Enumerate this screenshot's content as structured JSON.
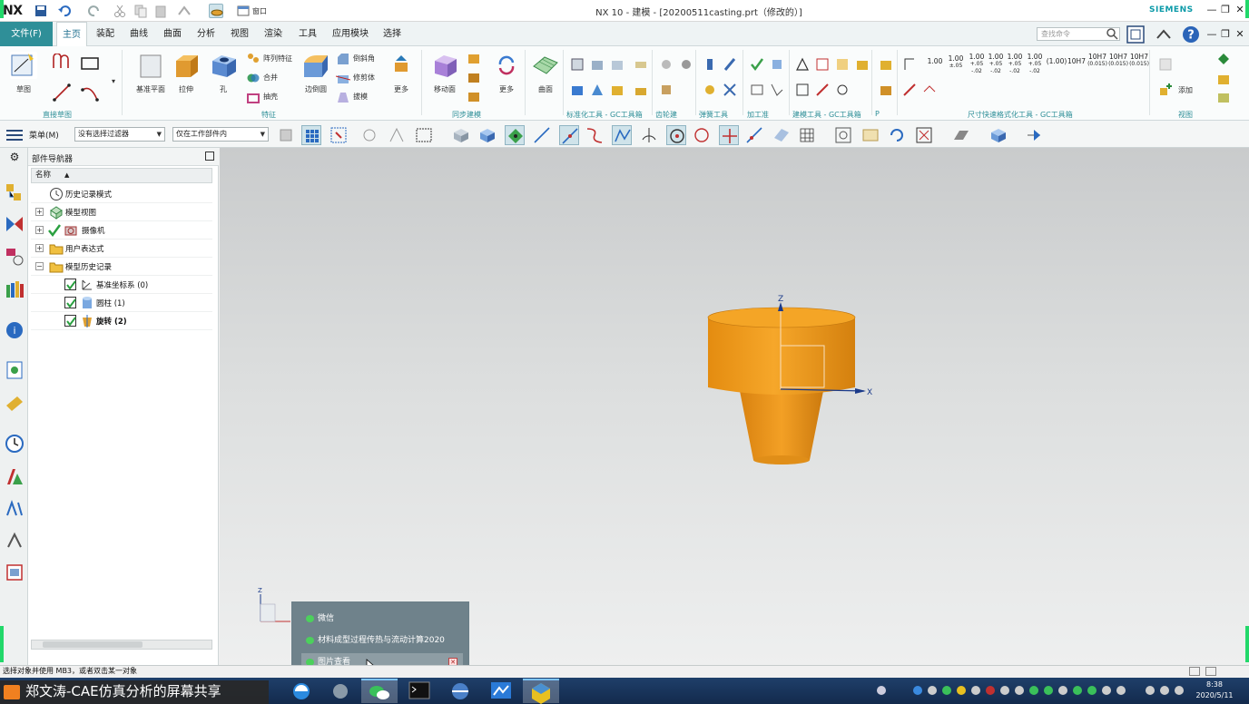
{
  "titlebar": {
    "logo": "NX",
    "window_menu": "窗口",
    "title": "NX 10 - 建模 - [20200511casting.prt（修改的）]",
    "brand": "SIEMENS",
    "min": "—",
    "restore": "❐",
    "close": "✕"
  },
  "menu_tabs": {
    "file": "文件(F)",
    "tabs": [
      "主页",
      "装配",
      "曲线",
      "曲面",
      "分析",
      "视图",
      "渲染",
      "工具",
      "应用模块",
      "选择"
    ],
    "search_placeholder": "查找命令"
  },
  "ribbon": {
    "big_buttons": [
      "草图",
      "基准平面",
      "拉伸",
      "孔",
      "边倒圆",
      "移动面",
      "更多",
      "更多",
      "曲面",
      "更多"
    ],
    "small_labels": [
      "阵列特征",
      "合并",
      "抽壳",
      "倒斜角",
      "修剪体",
      "拔模",
      "添加"
    ],
    "groups": [
      "直接草图",
      "特征",
      "同步建模",
      "标准化工具 - GC工具箱",
      "齿轮建",
      "弹簧工具",
      "加工准",
      "建模工具 - GC工具箱",
      "P",
      "尺寸快速格式化工具 - GC工具箱",
      "视图"
    ],
    "tolerances": [
      {
        "top": "1.00",
        "bottom": ""
      },
      {
        "top": "1.00",
        "bottom": "±.05"
      },
      {
        "top": "1.00",
        "bottom": "+.05 -.02"
      },
      {
        "top": "1.00",
        "bottom": "+.05 -.02"
      },
      {
        "top": "1.00",
        "bottom": "+.05 -.02"
      },
      {
        "top": "1.00",
        "bottom": "+.05 -.02"
      },
      {
        "top": "(1.00)",
        "bottom": ""
      },
      {
        "top": "10H7",
        "bottom": ""
      },
      {
        "top": "10H7",
        "bottom": "(0.015)"
      },
      {
        "top": "10H7",
        "bottom": "(0.015)"
      },
      {
        "top": "10H7",
        "bottom": "(0.015)"
      }
    ]
  },
  "selection_bar": {
    "menu": "菜单(M)",
    "filter": "没有选择过滤器",
    "scope": "仅在工作部件内"
  },
  "navigator": {
    "title": "部件导航器",
    "column": "名称",
    "rows": [
      {
        "label": "历史记录模式",
        "expand": ""
      },
      {
        "label": "模型视图",
        "expand": "+"
      },
      {
        "label": "摄像机",
        "expand": "+"
      },
      {
        "label": "用户表达式",
        "expand": "+"
      },
      {
        "label": "模型历史记录",
        "expand": "−"
      },
      {
        "label": "基准坐标系 (0)",
        "expand": ""
      },
      {
        "label": "圆柱 (1)",
        "expand": ""
      },
      {
        "label": "旋转 (2)",
        "expand": ""
      }
    ]
  },
  "graphics": {
    "axis_z": "Z",
    "axis_x": "X",
    "triad_z": "Z",
    "colors": {
      "body": "#f39b1a",
      "body_dark": "#c97810",
      "body_light": "#f7b447"
    }
  },
  "status": {
    "text": "选择对象并使用 MB3，或者双击某一对象"
  },
  "popup": {
    "items": [
      "微信",
      "材料成型过程传热与流动计算2020",
      "图片查看"
    ],
    "close": "✕"
  },
  "taskbar": {
    "share_banner": "郑文涛-CAE仿真分析的屏幕共享",
    "time": "8:38",
    "date": "2020/5/11"
  }
}
